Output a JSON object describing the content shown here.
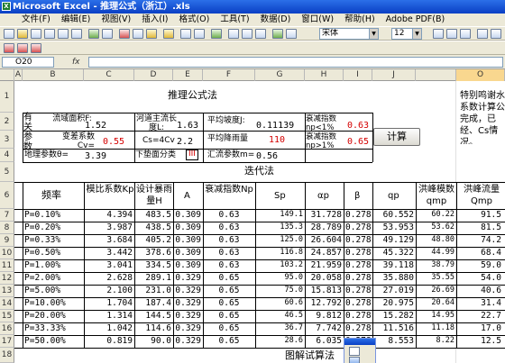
{
  "window": {
    "title": "Microsoft Excel - 推理公式（浙江）.xls",
    "app_icon": "excel-icon"
  },
  "menu": [
    "文件(F)",
    "编辑(E)",
    "视图(V)",
    "插入(I)",
    "格式(O)",
    "工具(T)",
    "数据(D)",
    "窗口(W)",
    "帮助(H)",
    "Adobe PDF(B)"
  ],
  "format": {
    "font": "宋体",
    "size": "12"
  },
  "namebox": "O20",
  "columns": [
    "A",
    "B",
    "C",
    "D",
    "E",
    "F",
    "G",
    "H",
    "I",
    "J",
    "",
    "O"
  ],
  "rows": [
    "1",
    "2",
    "3",
    "4",
    "5",
    "6",
    "7",
    "8",
    "9",
    "10",
    "11",
    "12",
    "13",
    "14",
    "15",
    "16",
    "17",
    "18"
  ],
  "sheet": {
    "title": "推理公式法",
    "side_label": "有关参数",
    "basin_area_label": "流域面积F:",
    "basin_area": "1.52",
    "river_len_label": "河道主流长度L:",
    "river_len": "1.63",
    "avg_slope_label": "平均坡度J:",
    "avg_slope": "0.11139",
    "decay1_label": "衰减指数np<1%",
    "decay1": "0.63",
    "cv_label": "变差系数Cv=",
    "cv": "0.55",
    "cs_label": "Cs=4Cv",
    "cs": "2.2",
    "rain_label": "平均降雨量",
    "rain": "110",
    "decay2_label": "衰减指数np>1%",
    "decay2": "0.65",
    "geo_label": "地理参数θ=",
    "geo": "3.39",
    "surface_label": "下垫面分类",
    "surface": "III",
    "conf_label": "汇流参数m=",
    "conf": "0.56",
    "calc_btn": "计算",
    "note": "特别鸣谢水系数计算公完成，已经、Cs情况。",
    "iter_title": "迭代法",
    "graph_title": "图解试算法"
  },
  "table": {
    "headers": [
      "频率",
      "模比系数Kp",
      "设计暴雨量H",
      "A",
      "衰减指数Np",
      "Sp",
      "αp",
      "β",
      "qp",
      "洪峰模数qmp",
      "洪峰流量Qmp"
    ],
    "rows": [
      [
        "P=0.10%",
        "4.394",
        "483.5",
        "0.309",
        "0.63",
        "149.1",
        "31.728",
        "0.278",
        "60.552",
        "60.22",
        "91.5"
      ],
      [
        "P=0.20%",
        "3.987",
        "438.5",
        "0.309",
        "0.63",
        "135.3",
        "28.789",
        "0.278",
        "53.953",
        "53.62",
        "81.5"
      ],
      [
        "P=0.33%",
        "3.684",
        "405.2",
        "0.309",
        "0.63",
        "125.0",
        "26.604",
        "0.278",
        "49.129",
        "48.80",
        "74.2"
      ],
      [
        "P=0.50%",
        "3.442",
        "378.6",
        "0.309",
        "0.63",
        "116.8",
        "24.857",
        "0.278",
        "45.322",
        "44.99",
        "68.4"
      ],
      [
        "P=1.00%",
        "3.041",
        "334.5",
        "0.309",
        "0.63",
        "103.2",
        "21.959",
        "0.278",
        "39.118",
        "38.79",
        "59.0"
      ],
      [
        "P=2.00%",
        "2.628",
        "289.1",
        "0.329",
        "0.65",
        "95.0",
        "20.058",
        "0.278",
        "35.880",
        "35.55",
        "54.0"
      ],
      [
        "P=5.00%",
        "2.100",
        "231.0",
        "0.329",
        "0.65",
        "75.0",
        "15.813",
        "0.278",
        "27.019",
        "26.69",
        "40.6"
      ],
      [
        "P=10.00%",
        "1.704",
        "187.4",
        "0.329",
        "0.65",
        "60.6",
        "12.792",
        "0.278",
        "20.975",
        "20.64",
        "31.4"
      ],
      [
        "P=20.00%",
        "1.314",
        "144.5",
        "0.329",
        "0.65",
        "46.5",
        "9.812",
        "0.278",
        "15.282",
        "14.95",
        "22.7"
      ],
      [
        "P=33.33%",
        "1.042",
        "114.6",
        "0.329",
        "0.65",
        "36.7",
        "7.742",
        "0.278",
        "11.516",
        "11.18",
        "17.0"
      ],
      [
        "P=50.00%",
        "0.819",
        "90.0",
        "0.329",
        "0.65",
        "28.6",
        "6.035",
        "0.278",
        "8.553",
        "8.22",
        "12.5"
      ]
    ]
  }
}
